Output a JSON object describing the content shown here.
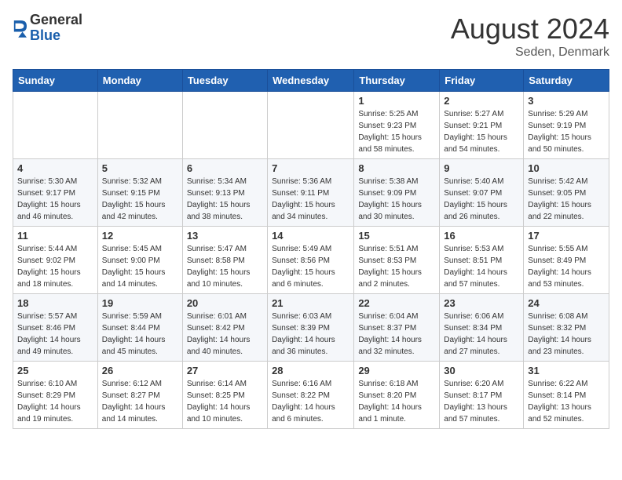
{
  "header": {
    "logo": {
      "general": "General",
      "blue": "Blue"
    },
    "month": "August 2024",
    "location": "Seden, Denmark"
  },
  "weekdays": [
    "Sunday",
    "Monday",
    "Tuesday",
    "Wednesday",
    "Thursday",
    "Friday",
    "Saturday"
  ],
  "weeks": [
    [
      {
        "day": "",
        "info": []
      },
      {
        "day": "",
        "info": []
      },
      {
        "day": "",
        "info": []
      },
      {
        "day": "",
        "info": []
      },
      {
        "day": "1",
        "info": [
          "Sunrise: 5:25 AM",
          "Sunset: 9:23 PM",
          "Daylight: 15 hours",
          "and 58 minutes."
        ]
      },
      {
        "day": "2",
        "info": [
          "Sunrise: 5:27 AM",
          "Sunset: 9:21 PM",
          "Daylight: 15 hours",
          "and 54 minutes."
        ]
      },
      {
        "day": "3",
        "info": [
          "Sunrise: 5:29 AM",
          "Sunset: 9:19 PM",
          "Daylight: 15 hours",
          "and 50 minutes."
        ]
      }
    ],
    [
      {
        "day": "4",
        "info": [
          "Sunrise: 5:30 AM",
          "Sunset: 9:17 PM",
          "Daylight: 15 hours",
          "and 46 minutes."
        ]
      },
      {
        "day": "5",
        "info": [
          "Sunrise: 5:32 AM",
          "Sunset: 9:15 PM",
          "Daylight: 15 hours",
          "and 42 minutes."
        ]
      },
      {
        "day": "6",
        "info": [
          "Sunrise: 5:34 AM",
          "Sunset: 9:13 PM",
          "Daylight: 15 hours",
          "and 38 minutes."
        ]
      },
      {
        "day": "7",
        "info": [
          "Sunrise: 5:36 AM",
          "Sunset: 9:11 PM",
          "Daylight: 15 hours",
          "and 34 minutes."
        ]
      },
      {
        "day": "8",
        "info": [
          "Sunrise: 5:38 AM",
          "Sunset: 9:09 PM",
          "Daylight: 15 hours",
          "and 30 minutes."
        ]
      },
      {
        "day": "9",
        "info": [
          "Sunrise: 5:40 AM",
          "Sunset: 9:07 PM",
          "Daylight: 15 hours",
          "and 26 minutes."
        ]
      },
      {
        "day": "10",
        "info": [
          "Sunrise: 5:42 AM",
          "Sunset: 9:05 PM",
          "Daylight: 15 hours",
          "and 22 minutes."
        ]
      }
    ],
    [
      {
        "day": "11",
        "info": [
          "Sunrise: 5:44 AM",
          "Sunset: 9:02 PM",
          "Daylight: 15 hours",
          "and 18 minutes."
        ]
      },
      {
        "day": "12",
        "info": [
          "Sunrise: 5:45 AM",
          "Sunset: 9:00 PM",
          "Daylight: 15 hours",
          "and 14 minutes."
        ]
      },
      {
        "day": "13",
        "info": [
          "Sunrise: 5:47 AM",
          "Sunset: 8:58 PM",
          "Daylight: 15 hours",
          "and 10 minutes."
        ]
      },
      {
        "day": "14",
        "info": [
          "Sunrise: 5:49 AM",
          "Sunset: 8:56 PM",
          "Daylight: 15 hours",
          "and 6 minutes."
        ]
      },
      {
        "day": "15",
        "info": [
          "Sunrise: 5:51 AM",
          "Sunset: 8:53 PM",
          "Daylight: 15 hours",
          "and 2 minutes."
        ]
      },
      {
        "day": "16",
        "info": [
          "Sunrise: 5:53 AM",
          "Sunset: 8:51 PM",
          "Daylight: 14 hours",
          "and 57 minutes."
        ]
      },
      {
        "day": "17",
        "info": [
          "Sunrise: 5:55 AM",
          "Sunset: 8:49 PM",
          "Daylight: 14 hours",
          "and 53 minutes."
        ]
      }
    ],
    [
      {
        "day": "18",
        "info": [
          "Sunrise: 5:57 AM",
          "Sunset: 8:46 PM",
          "Daylight: 14 hours",
          "and 49 minutes."
        ]
      },
      {
        "day": "19",
        "info": [
          "Sunrise: 5:59 AM",
          "Sunset: 8:44 PM",
          "Daylight: 14 hours",
          "and 45 minutes."
        ]
      },
      {
        "day": "20",
        "info": [
          "Sunrise: 6:01 AM",
          "Sunset: 8:42 PM",
          "Daylight: 14 hours",
          "and 40 minutes."
        ]
      },
      {
        "day": "21",
        "info": [
          "Sunrise: 6:03 AM",
          "Sunset: 8:39 PM",
          "Daylight: 14 hours",
          "and 36 minutes."
        ]
      },
      {
        "day": "22",
        "info": [
          "Sunrise: 6:04 AM",
          "Sunset: 8:37 PM",
          "Daylight: 14 hours",
          "and 32 minutes."
        ]
      },
      {
        "day": "23",
        "info": [
          "Sunrise: 6:06 AM",
          "Sunset: 8:34 PM",
          "Daylight: 14 hours",
          "and 27 minutes."
        ]
      },
      {
        "day": "24",
        "info": [
          "Sunrise: 6:08 AM",
          "Sunset: 8:32 PM",
          "Daylight: 14 hours",
          "and 23 minutes."
        ]
      }
    ],
    [
      {
        "day": "25",
        "info": [
          "Sunrise: 6:10 AM",
          "Sunset: 8:29 PM",
          "Daylight: 14 hours",
          "and 19 minutes."
        ]
      },
      {
        "day": "26",
        "info": [
          "Sunrise: 6:12 AM",
          "Sunset: 8:27 PM",
          "Daylight: 14 hours",
          "and 14 minutes."
        ]
      },
      {
        "day": "27",
        "info": [
          "Sunrise: 6:14 AM",
          "Sunset: 8:25 PM",
          "Daylight: 14 hours",
          "and 10 minutes."
        ]
      },
      {
        "day": "28",
        "info": [
          "Sunrise: 6:16 AM",
          "Sunset: 8:22 PM",
          "Daylight: 14 hours",
          "and 6 minutes."
        ]
      },
      {
        "day": "29",
        "info": [
          "Sunrise: 6:18 AM",
          "Sunset: 8:20 PM",
          "Daylight: 14 hours",
          "and 1 minute."
        ]
      },
      {
        "day": "30",
        "info": [
          "Sunrise: 6:20 AM",
          "Sunset: 8:17 PM",
          "Daylight: 13 hours",
          "and 57 minutes."
        ]
      },
      {
        "day": "31",
        "info": [
          "Sunrise: 6:22 AM",
          "Sunset: 8:14 PM",
          "Daylight: 13 hours",
          "and 52 minutes."
        ]
      }
    ]
  ]
}
